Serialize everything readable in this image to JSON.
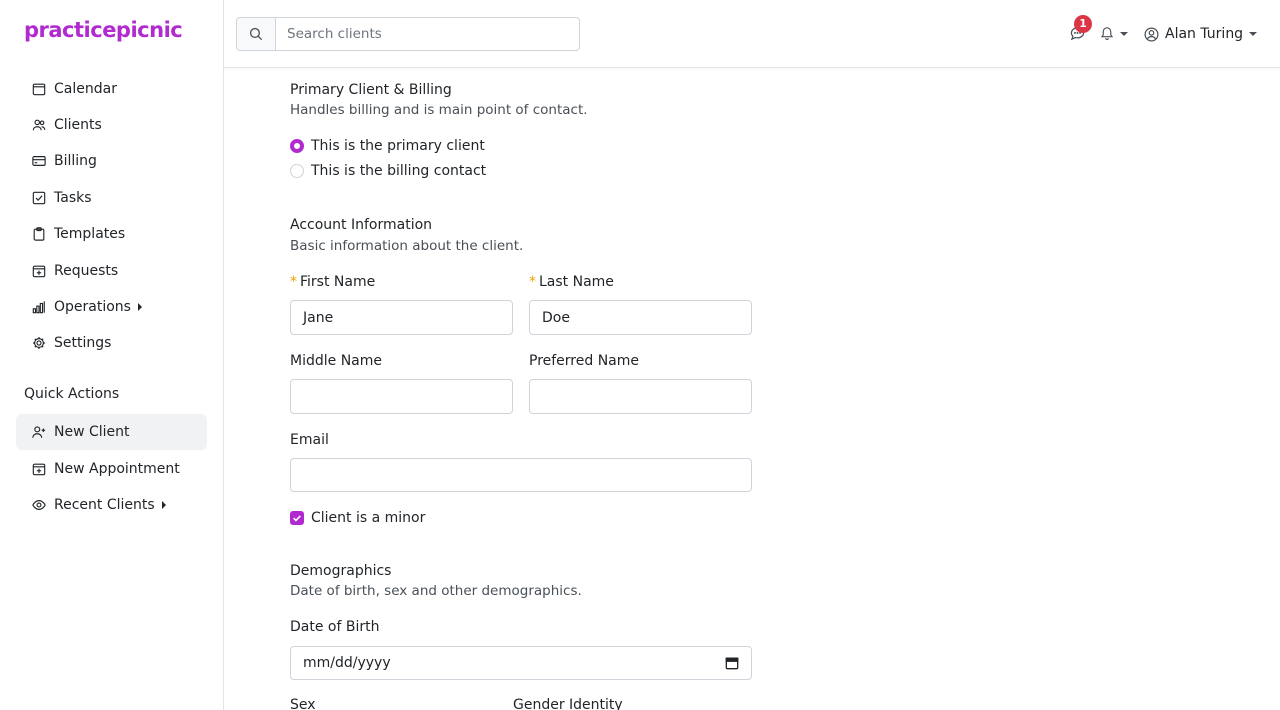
{
  "brand": {
    "name": "practicepicnic",
    "color": "#b12ad0"
  },
  "sidebar": {
    "items": [
      {
        "label": "Calendar",
        "icon": "calendar-icon"
      },
      {
        "label": "Clients",
        "icon": "users-icon"
      },
      {
        "label": "Billing",
        "icon": "credit-card-icon"
      },
      {
        "label": "Tasks",
        "icon": "check-square-icon"
      },
      {
        "label": "Templates",
        "icon": "clipboard-icon"
      },
      {
        "label": "Requests",
        "icon": "calendar-plus-icon"
      },
      {
        "label": "Operations",
        "icon": "bar-chart-icon"
      },
      {
        "label": "Settings",
        "icon": "gear-icon"
      }
    ],
    "quick_actions_title": "Quick Actions",
    "quick_actions": [
      {
        "label": "New Client",
        "icon": "user-plus-icon",
        "active": true
      },
      {
        "label": "New Appointment",
        "icon": "calendar-plus-icon"
      },
      {
        "label": "Recent Clients",
        "icon": "eye-icon"
      }
    ]
  },
  "topbar": {
    "search_placeholder": "Search clients",
    "messages_badge": "1",
    "user_name": "Alan Turing"
  },
  "form": {
    "primary": {
      "title": "Primary Client & Billing",
      "subtitle": "Handles billing and is main point of contact.",
      "options": [
        "This is the primary client",
        "This is the billing contact"
      ],
      "selected": "This is the primary client"
    },
    "account": {
      "title": "Account Information",
      "subtitle": "Basic information about the client.",
      "first_name_label": "First Name",
      "first_name_value": "Jane",
      "last_name_label": "Last Name",
      "last_name_value": "Doe",
      "middle_name_label": "Middle Name",
      "middle_name_value": "",
      "preferred_name_label": "Preferred Name",
      "preferred_name_value": "",
      "email_label": "Email",
      "email_value": "",
      "minor_label": "Client is a minor",
      "minor_checked": true
    },
    "demographics": {
      "title": "Demographics",
      "subtitle": "Date of birth, sex and other demographics.",
      "dob_label": "Date of Birth",
      "dob_placeholder": "mm/dd/yyyy",
      "sex_label": "Sex",
      "gender_label": "Gender Identity"
    }
  }
}
